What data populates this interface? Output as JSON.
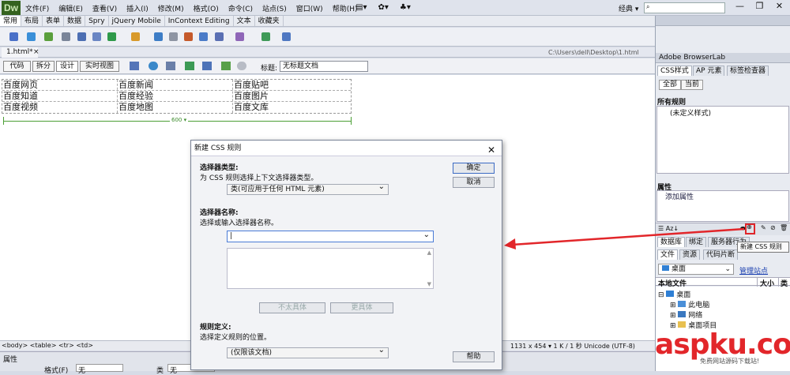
{
  "app": {
    "logo": "Dw",
    "workspace": "经典 ▾",
    "search_placeholder": "",
    "window_buttons": [
      "—",
      "❐",
      "✕"
    ]
  },
  "menu": [
    "文件(F)",
    "编辑(E)",
    "查看(V)",
    "插入(I)",
    "修改(M)",
    "格式(O)",
    "命令(C)",
    "站点(S)",
    "窗口(W)",
    "帮助(H)"
  ],
  "menu_icons": [
    "▤▾",
    "✿▾",
    "♣▾"
  ],
  "insert_tabs": [
    "常用",
    "布局",
    "表单",
    "数据",
    "Spry",
    "jQuery Mobile",
    "InContext Editing",
    "文本",
    "收藏夹"
  ],
  "document": {
    "tab": "1.html*",
    "tab_close": "×",
    "path": "C:\\Users\\dell\\Desktop\\1.html",
    "views": [
      "代码",
      "拆分",
      "设计",
      "实时视图"
    ],
    "title_label": "标题:",
    "title_value": "无标题文档",
    "table_rows": [
      [
        "百度网页",
        "百度新闻",
        "百度贴吧"
      ],
      [
        "百度知道",
        "百度经验",
        "百度图片"
      ],
      [
        "百度视频",
        "百度地图",
        "百度文库"
      ]
    ],
    "ruler_label": "600 ▾",
    "tag_path": "<body> <table> <tr> <td>",
    "status_info": "1131 x 454 ▾ 1 K / 1 秒 Unicode (UTF-8)"
  },
  "properties_bar": {
    "label": "属性",
    "format_label": "格式(F)",
    "format_value": "无",
    "class_label": "类",
    "class_value": "无"
  },
  "right_panel": {
    "browserlab": "Adobe BrowserLab",
    "css_tabs": [
      "CSS样式",
      "AP 元素",
      "标签检查器"
    ],
    "css_buttons": [
      "全部",
      "当前"
    ],
    "all_rules": "所有规则",
    "rule_item": "(未定义样式)",
    "props_title": "属性",
    "add_property": "添加属性",
    "db_tabs": [
      "数据库",
      "绑定",
      "服务器行为"
    ],
    "file_tabs": [
      "文件",
      "资源",
      "代码片断"
    ],
    "site_select": "桌面",
    "manage_sites": "管理站点",
    "local_files": "本地文件",
    "size_col": "大小",
    "type_col": "类",
    "tree": [
      "桌面",
      "此电脑",
      "网络",
      "桌面项目"
    ],
    "tooltip": "新建 CSS 规则"
  },
  "dialog": {
    "title": "新建 CSS 规则",
    "close": "✕",
    "selector_type_label": "选择器类型:",
    "selector_type_desc": "为 CSS 规则选择上下文选择器类型。",
    "selector_type_value": "类(可应用于任何 HTML 元素)",
    "selector_name_label": "选择器名称:",
    "selector_name_desc": "选择或输入选择器名称。",
    "selector_name_value": "|",
    "less_specific": "不太具体",
    "more_specific": "更具体",
    "rule_def_label": "规则定义:",
    "rule_def_desc": "选择定义规则的位置。",
    "rule_def_value": "(仅限该文档)",
    "ok": "确定",
    "cancel": "取消",
    "help": "帮助"
  },
  "watermark": {
    "brand": "aspku.com",
    "sub": "免费网站源码下载站!"
  },
  "colors": {
    "accent_red": "#e2262a",
    "logo_green": "#35621f",
    "ruler_green": "#4b9f35"
  }
}
